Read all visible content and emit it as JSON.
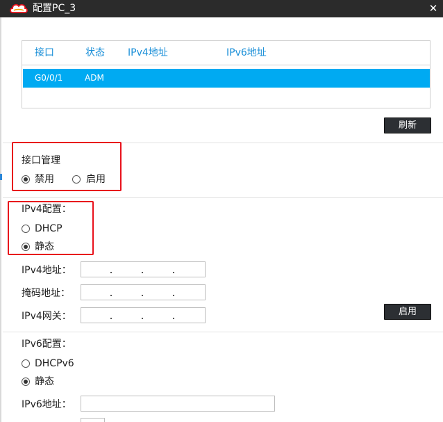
{
  "window": {
    "title": "配置PC_3",
    "close_glyph": "✕",
    "logo": "cloud-logo-icon"
  },
  "interfaces_table": {
    "columns": [
      "接口",
      "状态",
      "IPv4地址",
      "IPv6地址"
    ],
    "rows": [
      {
        "interface": "G0/0/1",
        "status": "ADM",
        "ipv4": "",
        "ipv6": ""
      }
    ],
    "selected_row_color": "#00aaf2"
  },
  "refresh_button": "刷新",
  "interface_mgmt": {
    "title": "接口管理",
    "disable": "禁用",
    "enable": "启用",
    "selected": "禁用"
  },
  "ipv4": {
    "title": "IPv4配置：",
    "dhcp": "DHCP",
    "static": "静态",
    "selected": "静态",
    "address_label": "IPv4地址：",
    "mask_label": "掩码地址：",
    "gateway_label": "IPv4网关：",
    "address_value": "",
    "mask_value": "",
    "gateway_value": "",
    "apply_button": "启用"
  },
  "ipv6": {
    "title": "IPv6配置：",
    "dhcp": "DHCPv6",
    "static": "静态",
    "selected": "静态",
    "address_label": "IPv6地址：",
    "address_value": ""
  },
  "colors": {
    "accent": "#1a8fd8",
    "highlight_box": "#e8101b",
    "titlebar": "#2b2b2b",
    "button": "#2c2f33"
  }
}
